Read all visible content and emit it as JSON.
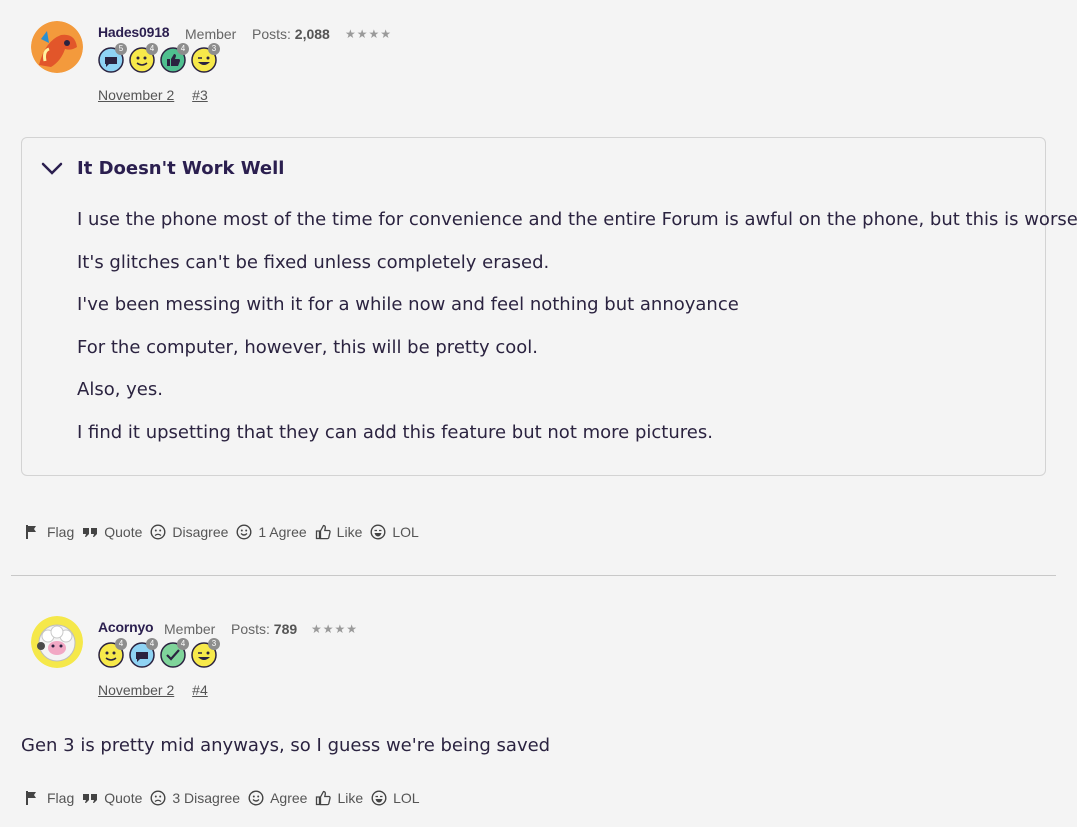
{
  "posts": [
    {
      "username": "Hades0918",
      "role": "Member",
      "posts_label": "Posts:",
      "posts_count": "2,088",
      "stars": "★★★★",
      "badges": [
        {
          "icon": "chat-bubble-badge-icon",
          "level": "5"
        },
        {
          "icon": "smiley-face-badge-icon",
          "level": "4"
        },
        {
          "icon": "thumbs-up-badge-icon",
          "level": "4"
        },
        {
          "icon": "winking-face-badge-icon",
          "level": "3"
        }
      ],
      "date": "November 2",
      "post_number": "#3",
      "spoiler": {
        "title": "It Doesn't Work Well",
        "paragraphs": [
          "I use the phone most of the time for convenience and the entire Forum is awful on the phone, but this is worse.",
          "It's glitches can't be fixed unless completely erased.",
          "I've been messing with it for a while now and feel nothing but annoyance",
          "For the computer, however, this will be pretty cool.",
          "Also, yes.",
          "I find it upsetting that they can add this feature but not more pictures."
        ]
      },
      "actions": {
        "flag": "Flag",
        "quote": "Quote",
        "disagree": "Disagree",
        "agree": "1 Agree",
        "like": "Like",
        "lol": "LOL"
      }
    },
    {
      "username": "Acornyo",
      "role": "Member",
      "posts_label": "Posts:",
      "posts_count": "789",
      "stars": "★★★★",
      "badges": [
        {
          "icon": "smiley-face-badge-icon",
          "level": "4"
        },
        {
          "icon": "chat-bubble-badge-icon",
          "level": "4"
        },
        {
          "icon": "check-mark-badge-icon",
          "level": "4"
        },
        {
          "icon": "winking-face-badge-icon",
          "level": "3"
        }
      ],
      "date": "November 2",
      "post_number": "#4",
      "body": "Gen 3 is pretty mid anyways, so I guess we're being saved",
      "actions": {
        "flag": "Flag",
        "quote": "Quote",
        "disagree": "3 Disagree",
        "agree": "Agree",
        "like": "Like",
        "lol": "LOL"
      }
    }
  ],
  "colors": {
    "background": "#f4f4f4",
    "username": "#2b1f4f",
    "body_text": "#2b2340",
    "meta_text": "#555555"
  }
}
